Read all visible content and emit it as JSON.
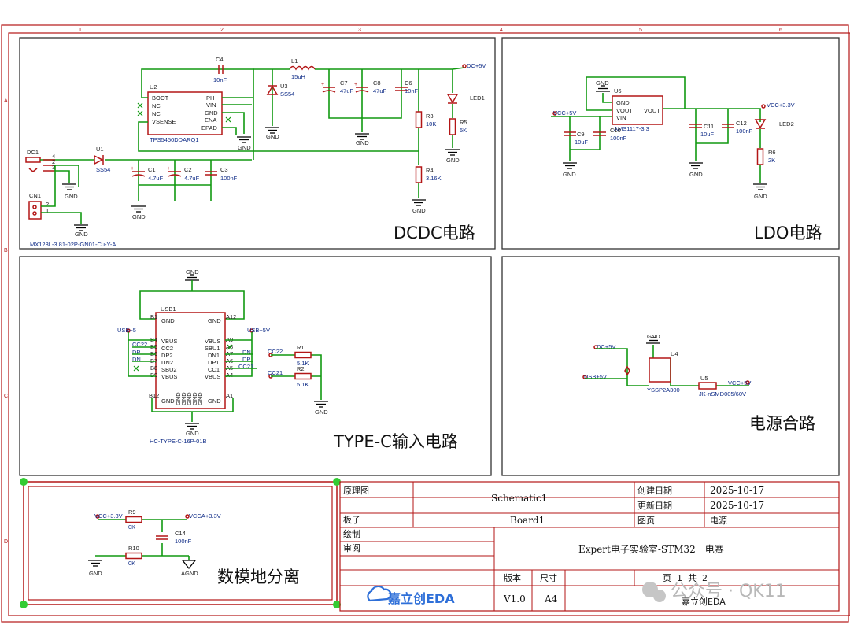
{
  "sections": {
    "dcdc": "DCDC电路",
    "ldo": "LDO电路",
    "typec": "TYPE-C输入电路",
    "power_merge": "电源合路",
    "analog_digital_ground": "数模地分离"
  },
  "ruler": {
    "columns": [
      "1",
      "2",
      "3",
      "4",
      "5",
      "6"
    ],
    "rows": [
      "A",
      "B",
      "C",
      "D"
    ]
  },
  "dcdc": {
    "dc1": "DC1",
    "cn1": "CN1",
    "cn1_part": "MX128L-3.81-02P-GN01-Cu-Y-A",
    "u1": "U1",
    "u1_part": "SS54",
    "u2": "U2",
    "u2_part": "TPS5450DDARQ1",
    "u2_pins_left": [
      "BOOT",
      "NC",
      "NC",
      "VSENSE"
    ],
    "u2_pins_right": [
      "PH",
      "VIN",
      "GND",
      "ENA",
      "EPAD"
    ],
    "u3": "U3",
    "u3_part": "SS54",
    "c1": "C1",
    "c1_val": "4.7uF",
    "c2": "C2",
    "c2_val": "4.7uF",
    "c3": "C3",
    "c3_val": "100nF",
    "c4": "C4",
    "c4_val": "10nF",
    "l1": "L1",
    "l1_val": "15uH",
    "c7": "C7",
    "c7_val": "47uF",
    "c8": "C8",
    "c8_val": "47uF",
    "c6": "C6",
    "c6_val": "10nF",
    "r3": "R3",
    "r3_val": "10K",
    "r4": "R4",
    "r4_val": "3.16K",
    "r5": "R5",
    "r5_val": "5K",
    "led1": "LED1",
    "net_out": "DC+5V"
  },
  "ldo": {
    "u6": "U6",
    "u6_part": "AMS1117-3.3",
    "u6_pins": [
      "GND",
      "VOUT",
      "VIN",
      "VOUT"
    ],
    "net_in": "VCC+5V",
    "net_out": "VCC+3.3V",
    "c9": "C9",
    "c9_val": "10uF",
    "c10": "C10",
    "c10_val": "100nF",
    "c11": "C11",
    "c11_val": "10uF",
    "c12": "C12",
    "c12_val": "100nF",
    "led2": "LED2",
    "r6": "R6",
    "r6_val": "2K"
  },
  "typec": {
    "usb1": "USB1",
    "part": "HC-TYPE-C-16P-01B",
    "pins_left": [
      "GND",
      "VBUS",
      "CC2",
      "DP2",
      "DN2",
      "SBU2",
      "VBUS"
    ],
    "pins_right": [
      "GND",
      "VBUS",
      "SBU1",
      "DN1",
      "DP1",
      "CC1",
      "VBUS"
    ],
    "pins_bottom": [
      "GND",
      "GND",
      "GND",
      "GND",
      "GND"
    ],
    "pin_ids_left": [
      "B1",
      "B4",
      "B5",
      "B6",
      "B7",
      "B8",
      "B9",
      "B12"
    ],
    "pin_ids_right": [
      "A12",
      "A9",
      "A8",
      "A7",
      "A6",
      "A5",
      "A4",
      "A1"
    ],
    "net_usb_l": "USB+5",
    "net_usb_r": "USB+5V",
    "nets_left": [
      "CC22",
      "DP",
      "DN"
    ],
    "nets_right": [
      "DN",
      "DP",
      "CC21"
    ],
    "r1": "R1",
    "r1_val": "5.1K",
    "r2": "R2",
    "r2_val": "5.1K",
    "cc22": "CC22",
    "cc21": "CC21"
  },
  "merge": {
    "net_dc": "DC+5V",
    "net_usb": "USB+5V",
    "u4": "U4",
    "u4_part": "YSSP2A300",
    "u5": "U5",
    "u5_part": "JK-nSMD005/60V",
    "net_out": "VCC+5V"
  },
  "ground_split": {
    "net_vcc": "VCC+3.3V",
    "net_vcca": "VCCA+3.3V",
    "r9": "R9",
    "r9_val": "0K",
    "r10": "R10",
    "r10_val": "0K",
    "c14": "C14",
    "c14_val": "100nF",
    "gnd": "GND",
    "agnd": "AGND"
  },
  "common": {
    "gnd": "GND"
  },
  "title_block": {
    "schematic_label": "原理图",
    "schematic_value": "Schematic1",
    "board_label": "板子",
    "board_value": "Board1",
    "drawn_label": "绘制",
    "review_label": "审阅",
    "created_label": "创建日期",
    "created_value": "2025-10-17",
    "updated_label": "更新日期",
    "updated_value": "2025-10-17",
    "page_label": "图页",
    "page_value": "电源",
    "project": "Expert电子实验室-STM32一电赛",
    "version_label": "版本",
    "version_value": "V1.0",
    "size_label": "尺寸",
    "size_value": "A4",
    "pages_text": "页  1  共  2",
    "logo_text": "嘉立创EDA",
    "company": "嘉立创EDA"
  },
  "watermark": "公众号 · QK11"
}
